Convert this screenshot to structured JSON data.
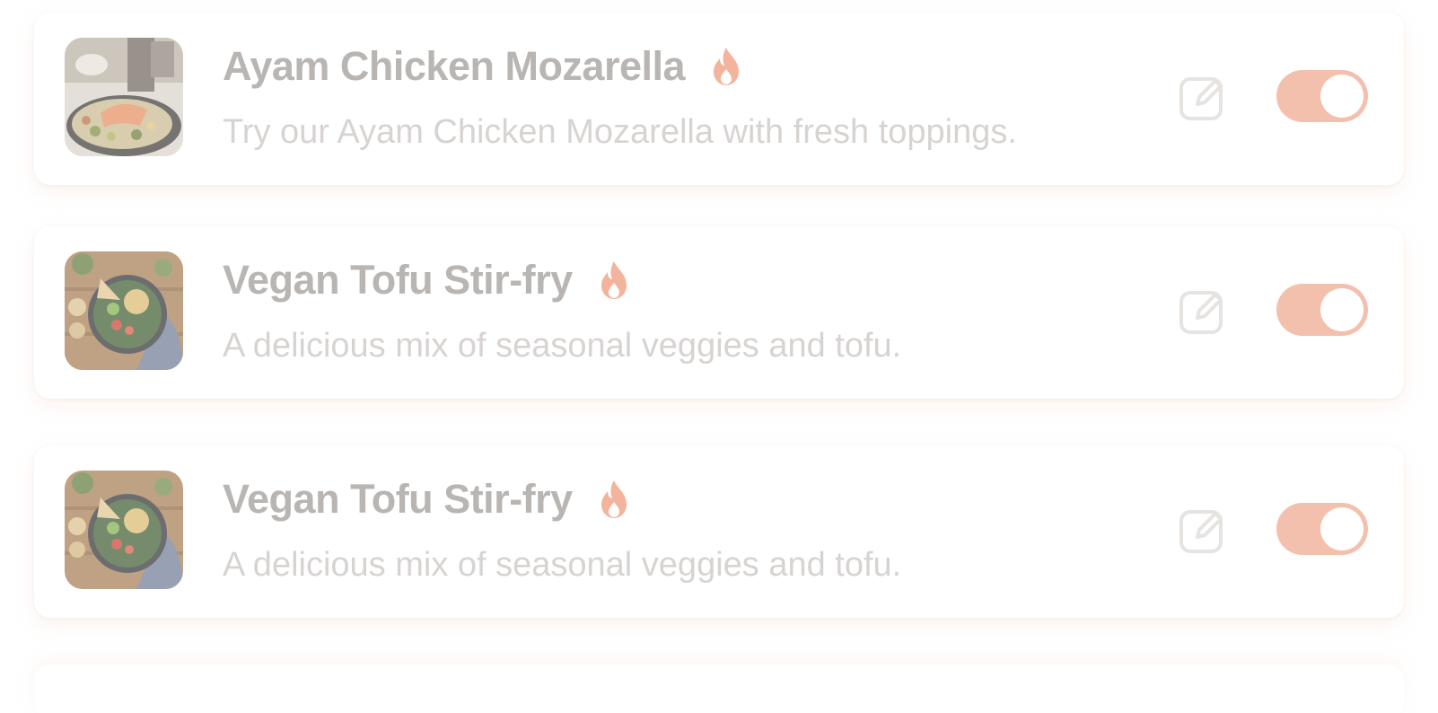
{
  "menu_items": [
    {
      "title": "Ayam Chicken Mozarella",
      "description": "Try our Ayam Chicken Mozarella with fresh toppings.",
      "badge_icon": "flame-icon",
      "image": "chicken-dish-photo",
      "enabled": true
    },
    {
      "title": "Vegan Tofu Stir-fry",
      "description": "A delicious mix of seasonal veggies and tofu.",
      "badge_icon": "flame-icon",
      "image": "vegan-bowl-photo",
      "enabled": true
    },
    {
      "title": "Vegan Tofu Stir-fry",
      "description": "A delicious mix of seasonal veggies and tofu.",
      "badge_icon": "flame-icon",
      "image": "vegan-bowl-photo",
      "enabled": true
    }
  ],
  "colors": {
    "accent": "#f3c0ae",
    "title_text": "#b9b5b2",
    "description_text": "#d7d3d1",
    "icon_stroke": "#e6e3e1"
  }
}
